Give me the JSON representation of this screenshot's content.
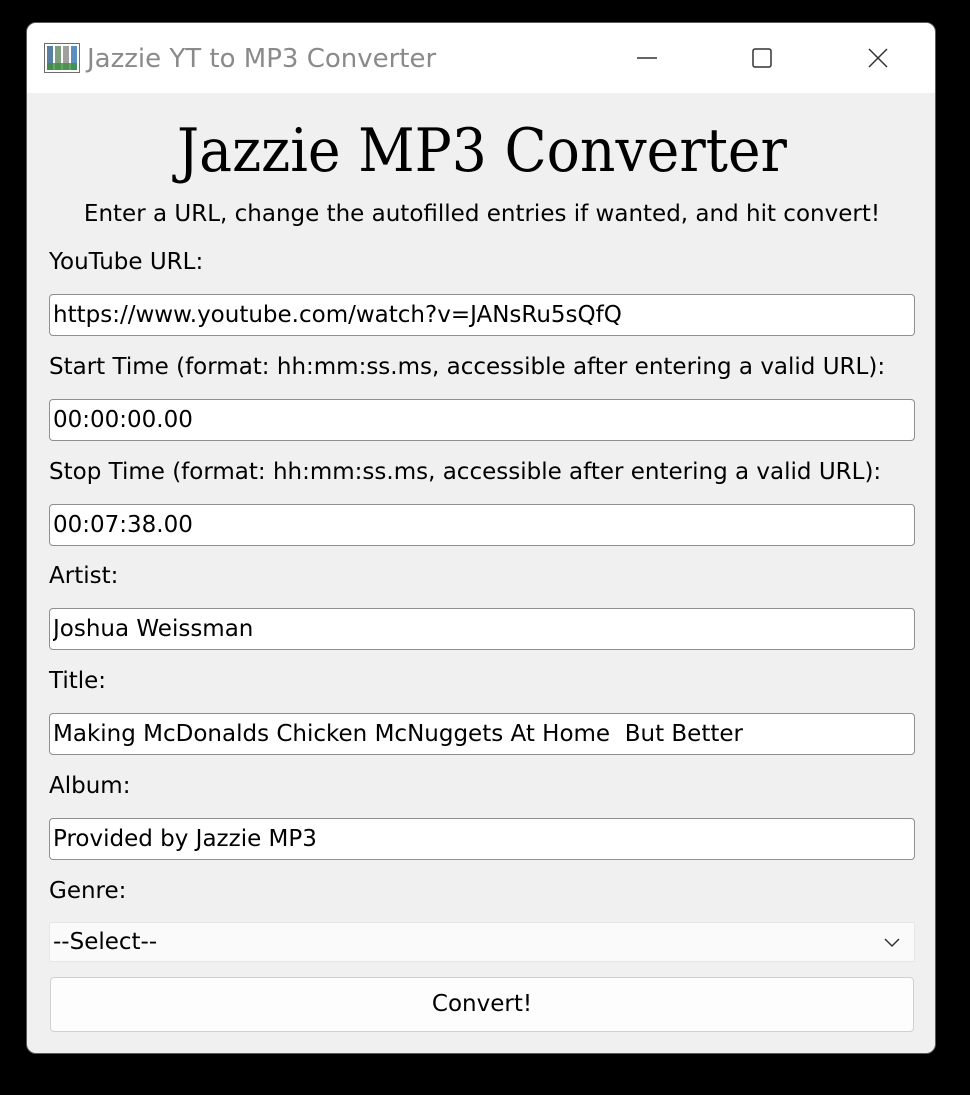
{
  "window": {
    "title": "Jazzie YT to MP3 Converter",
    "controls": {
      "minimize": "minimize-icon",
      "maximize": "maximize-icon",
      "close": "close-icon"
    }
  },
  "header": {
    "title": "Jazzie MP3 Converter",
    "instructions": "Enter a URL, change the autofilled entries if wanted, and hit convert!"
  },
  "form": {
    "url": {
      "label": "YouTube URL:",
      "value": "https://www.youtube.com/watch?v=JANsRu5sQfQ"
    },
    "start_time": {
      "label": "Start Time (format: hh:mm:ss.ms, accessible after entering a valid URL):",
      "value": "00:00:00.00"
    },
    "stop_time": {
      "label": "Stop Time (format: hh:mm:ss.ms, accessible after entering a valid URL):",
      "value": "00:07:38.00"
    },
    "artist": {
      "label": "Artist:",
      "value": "Joshua Weissman"
    },
    "title": {
      "label": "Title:",
      "value": "Making McDonalds Chicken McNuggets At Home  But Better"
    },
    "album": {
      "label": "Album:",
      "value": "Provided by Jazzie MP3"
    },
    "genre": {
      "label": "Genre:",
      "selected": "--Select--"
    },
    "convert_label": "Convert!"
  }
}
